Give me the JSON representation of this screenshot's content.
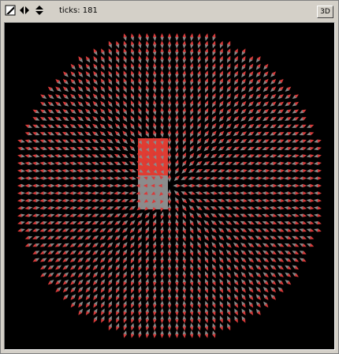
{
  "toolbar": {
    "ticks_label": "ticks:",
    "ticks_value": "181",
    "view3d_label": "3D",
    "icons": [
      "edit-icon",
      "horizontal-arrows-icon",
      "vertical-arrows-icon"
    ]
  },
  "world": {
    "background_color": "#000000",
    "patch_color_top": "#e03c32",
    "patch_color_bottom": "#8c8c8c",
    "turtle_color_red": "#d83a3a",
    "turtle_color_gray": "#8a8a8a",
    "turtle_shape": "arrow",
    "turtle_heading_pattern": "radial-outward",
    "turtle_layout": "grid-disk"
  }
}
